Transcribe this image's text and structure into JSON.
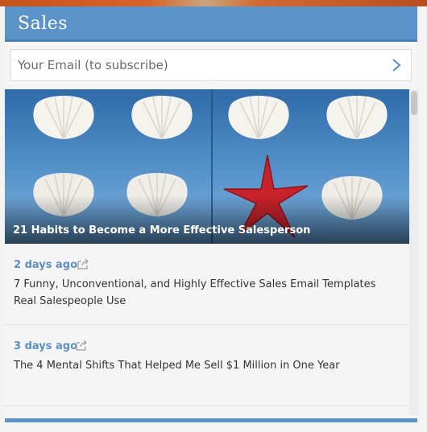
{
  "header": {
    "title": "Sales"
  },
  "subscribe": {
    "placeholder": "Your Email (to subscribe)",
    "submit_icon": "chevron-right-icon"
  },
  "featured": {
    "caption": "21 Habits to Become a More Effective Salesperson"
  },
  "posts": [
    {
      "time": "2 days ago",
      "share_icon": "share-icon",
      "title": "7 Funny, Unconventional, and Highly Effective Sales Email Templates Real Salespeople Use"
    },
    {
      "time": "3 days ago",
      "share_icon": "share-icon",
      "title": "The 4 Mental Shifts That Helped Me Sell $1 Million in One Year"
    }
  ],
  "colors": {
    "accent": "#5b93c9",
    "link": "#5b8fc4",
    "starfish": "#c8232a"
  }
}
